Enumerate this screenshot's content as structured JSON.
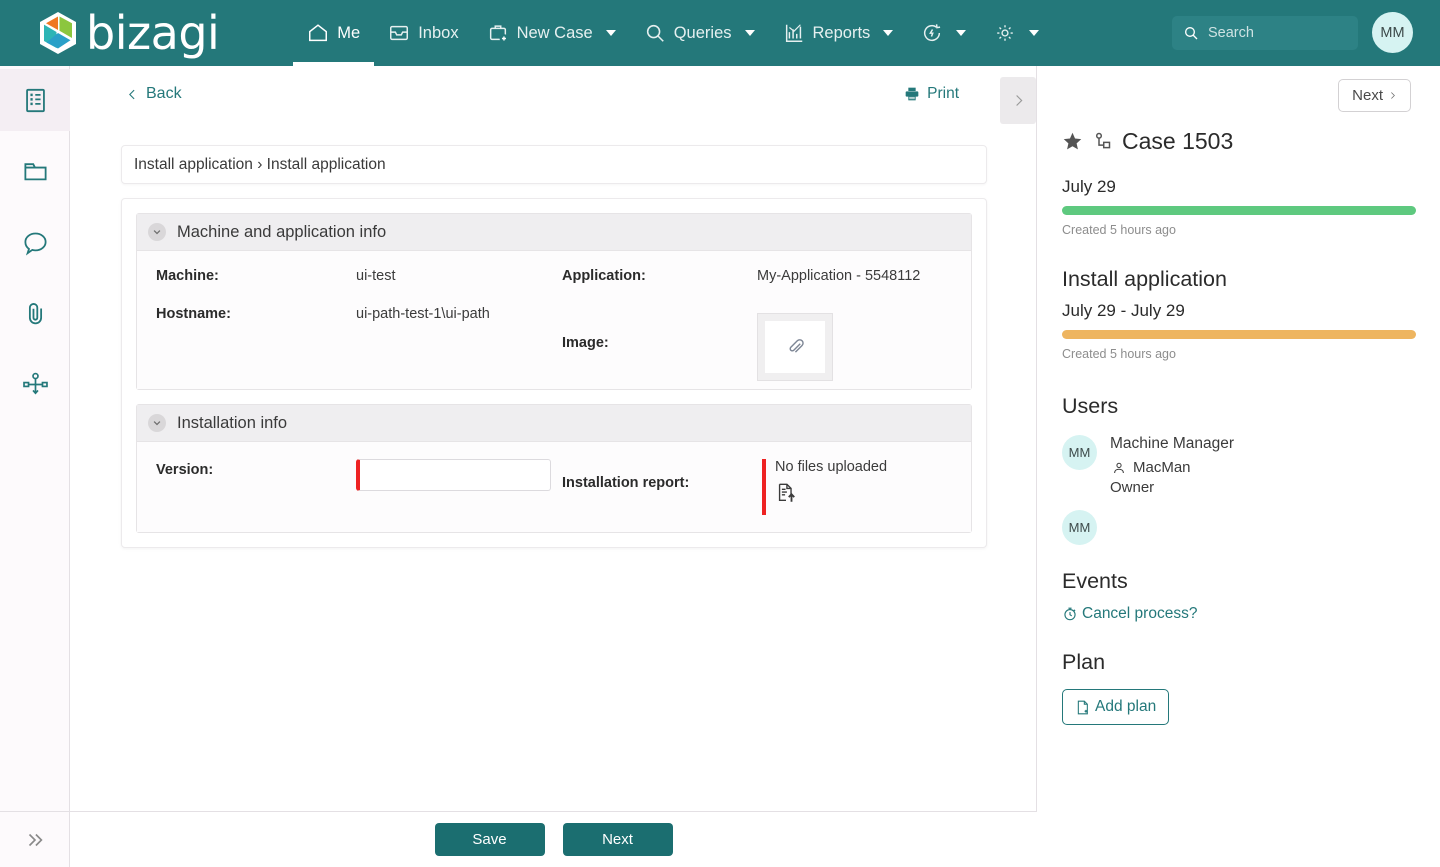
{
  "header": {
    "brand": "bizagi",
    "nav": [
      {
        "label": "Me",
        "icon": "home-icon",
        "active": true,
        "caret": false
      },
      {
        "label": "Inbox",
        "icon": "inbox-icon",
        "active": false,
        "caret": false
      },
      {
        "label": "New Case",
        "icon": "briefcase-plus-icon",
        "active": false,
        "caret": true
      },
      {
        "label": "Queries",
        "icon": "search-icon",
        "active": false,
        "caret": true
      },
      {
        "label": "Reports",
        "icon": "chart-icon",
        "active": false,
        "caret": true
      },
      {
        "label": "",
        "icon": "refresh-bolt-icon",
        "active": false,
        "caret": true
      },
      {
        "label": "",
        "icon": "gear-icon",
        "active": false,
        "caret": true
      }
    ],
    "search_placeholder": "Search",
    "avatar_initials": "MM",
    "accent_color": "#24787a"
  },
  "rail": {
    "items": [
      {
        "name": "form-icon",
        "active": true
      },
      {
        "name": "folder-icon",
        "active": false
      },
      {
        "name": "comment-icon",
        "active": false
      },
      {
        "name": "paperclip-icon",
        "active": false
      },
      {
        "name": "process-diagram-icon",
        "active": false
      }
    ],
    "expand_label": "expand"
  },
  "toolbar": {
    "back_label": "Back",
    "print_label": "Print"
  },
  "breadcrumb": "Install application › Install application",
  "form": {
    "sections": [
      {
        "title": "Machine and application info",
        "fields": {
          "machine_label": "Machine:",
          "machine_value": "ui-test",
          "hostname_label": "Hostname:",
          "hostname_value": "ui-path-test-1\\ui-path",
          "application_label": "Application:",
          "application_value": "My-Application - 5548112",
          "image_label": "Image:"
        }
      },
      {
        "title": "Installation info",
        "fields": {
          "version_label": "Version:",
          "version_value": "",
          "report_label": "Installation report:",
          "report_status": "No files uploaded"
        }
      }
    ]
  },
  "right_panel": {
    "next_top_label": "Next",
    "case_title": "Case 1503",
    "case_date": "July 29",
    "case_progress_color": "#5ec97f",
    "case_created": "Created 5 hours ago",
    "stage_title": "Install application",
    "stage_dates": "July 29 - July 29",
    "stage_progress_color": "#eeb560",
    "stage_created": "Created 5 hours ago",
    "users_heading": "Users",
    "users": [
      {
        "initials": "MM",
        "name": "Machine Manager",
        "userid": "MacMan",
        "role": "Owner"
      },
      {
        "initials": "MM",
        "name": "",
        "userid": "",
        "role": ""
      }
    ],
    "events_heading": "Events",
    "event_link": "Cancel process?",
    "plan_heading": "Plan",
    "add_plan_label": "Add plan"
  },
  "footer": {
    "save_label": "Save",
    "next_label": "Next"
  }
}
